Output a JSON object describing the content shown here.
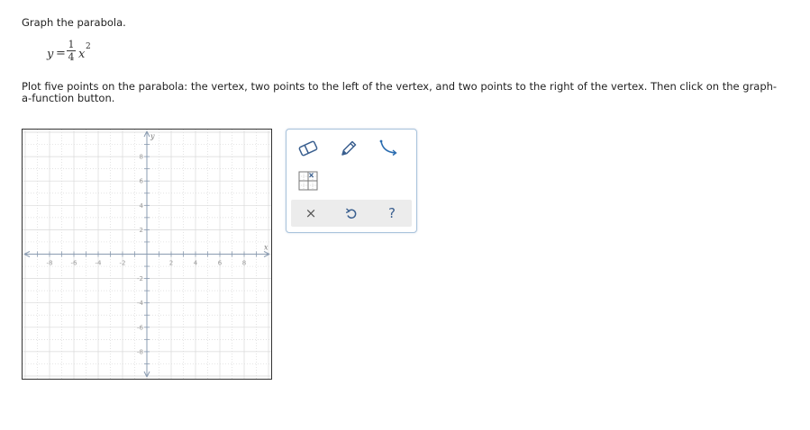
{
  "question": {
    "prompt": "Graph the parabola.",
    "equation": {
      "lhs": "y",
      "equals": "=",
      "numerator": "1",
      "denominator": "4",
      "variable": "x",
      "exponent": "2"
    },
    "instructions": "Plot five points on the parabola: the vertex, two points to the left of the vertex, and two points to the right of the vertex. Then click on the graph-a-function button."
  },
  "graph": {
    "x_axis_label": "x",
    "y_axis_label": "y",
    "x_range": [
      -10,
      10
    ],
    "y_range": [
      -10,
      10
    ],
    "x_tick_labels": [
      {
        "value": -8,
        "label": "-8"
      },
      {
        "value": -6,
        "label": "-6"
      },
      {
        "value": -4,
        "label": "-4"
      },
      {
        "value": -2,
        "label": "-2"
      },
      {
        "value": 2,
        "label": "2"
      },
      {
        "value": 4,
        "label": "4"
      },
      {
        "value": 6,
        "label": "6"
      },
      {
        "value": 8,
        "label": "8"
      }
    ],
    "y_tick_labels": [
      {
        "value": 8,
        "label": "8"
      },
      {
        "value": 6,
        "label": "6"
      },
      {
        "value": 4,
        "label": "4"
      },
      {
        "value": 2,
        "label": "2"
      },
      {
        "value": -2,
        "label": "-2"
      },
      {
        "value": -4,
        "label": "-4"
      },
      {
        "value": -6,
        "label": "-6"
      },
      {
        "value": -8,
        "label": "-8"
      }
    ],
    "grid": true,
    "colors": {
      "grid": "#d9d9d9",
      "axis": "#8a9bb0",
      "tick_label": "#999999"
    }
  },
  "toolbox": {
    "tools": [
      {
        "id": "eraser",
        "icon": "eraser-icon"
      },
      {
        "id": "pencil",
        "icon": "pencil-icon"
      },
      {
        "id": "curve",
        "icon": "curve-icon"
      },
      {
        "id": "graph-function",
        "icon": "graph-function-icon"
      }
    ],
    "actions": {
      "clear_symbol": "×",
      "help_symbol": "?",
      "undo_icon": "undo-icon"
    },
    "colors": {
      "icon": "#3a5f8f",
      "accent": "#2a6cb0",
      "border": "#a9c3dc",
      "action_bar": "#ececec"
    }
  }
}
